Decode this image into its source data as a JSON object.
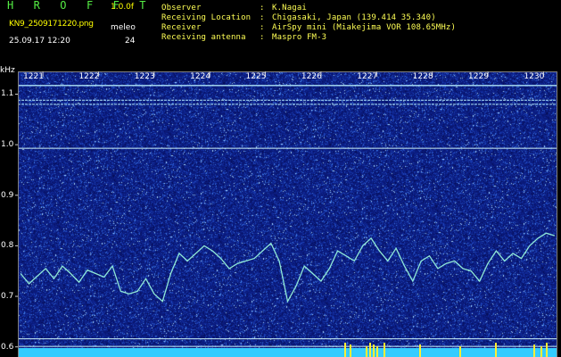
{
  "header": {
    "title": "H R O F F T",
    "version": "1.0.0f",
    "filename": "KN9_2509171220.png",
    "meleo_label": "meleo",
    "datetime": "25.09.17 12:20",
    "meleo_value": "24"
  },
  "info": {
    "rows": [
      {
        "key": "Observer",
        "sep": ":",
        "value": "K.Nagai"
      },
      {
        "key": "Receiving Location",
        "sep": ":",
        "value": "Chigasaki, Japan (139.414 35.340)"
      },
      {
        "key": "Receiver",
        "sep": ":",
        "value": "AirSpy mini (Miakejima VOR 108.65MHz)"
      },
      {
        "key": "Receiving antenna",
        "sep": ":",
        "value": "Maspro FM-3"
      }
    ]
  },
  "colors": {
    "title_green": "#55ee44",
    "info_yellow": "#ffff55",
    "spectrogram_bg": "#0a1a7a",
    "signal": "#9fffe0",
    "noise_bar": "#33ccff",
    "burst": "#ffee33"
  },
  "chart_data": {
    "type": "heatmap",
    "ylabel": "kHz",
    "y_ticks": [
      "1.1",
      "1.0",
      "0.9",
      "0.8",
      "0.7",
      "0.6"
    ],
    "x_ticks": [
      "1221",
      "1222",
      "1223",
      "1224",
      "1225",
      "1226",
      "1227",
      "1228",
      "1229",
      "1230"
    ],
    "ylim": [
      0.58,
      1.145
    ],
    "xlim": [
      1220.55,
      1230.25
    ],
    "steady_lines_khz": [
      1.117,
      1.088,
      1.08,
      0.993,
      0.616,
      0.601
    ],
    "doppler_trace": {
      "x": [
        1220.6,
        1220.75,
        1220.9,
        1221.05,
        1221.2,
        1221.35,
        1221.5,
        1221.65,
        1221.8,
        1221.95,
        1222.1,
        1222.25,
        1222.4,
        1222.55,
        1222.7,
        1222.85,
        1223.0,
        1223.15,
        1223.3,
        1223.45,
        1223.6,
        1223.75,
        1223.9,
        1224.05,
        1224.2,
        1224.35,
        1224.5,
        1224.65,
        1224.8,
        1224.95,
        1225.1,
        1225.25,
        1225.4,
        1225.55,
        1225.7,
        1225.85,
        1226.0,
        1226.15,
        1226.3,
        1226.45,
        1226.6,
        1226.75,
        1226.9,
        1227.05,
        1227.2,
        1227.35,
        1227.5,
        1227.65,
        1227.8,
        1227.95,
        1228.1,
        1228.25,
        1228.4,
        1228.55,
        1228.7,
        1228.85,
        1229.0,
        1229.15,
        1229.3,
        1229.45,
        1229.6,
        1229.75,
        1229.9,
        1230.05,
        1230.2
      ],
      "y": [
        0.745,
        0.725,
        0.74,
        0.755,
        0.735,
        0.76,
        0.745,
        0.728,
        0.752,
        0.745,
        0.738,
        0.76,
        0.71,
        0.705,
        0.71,
        0.735,
        0.705,
        0.69,
        0.745,
        0.785,
        0.77,
        0.785,
        0.8,
        0.79,
        0.775,
        0.755,
        0.765,
        0.77,
        0.775,
        0.79,
        0.805,
        0.77,
        0.69,
        0.72,
        0.76,
        0.745,
        0.73,
        0.755,
        0.79,
        0.78,
        0.77,
        0.8,
        0.815,
        0.79,
        0.77,
        0.795,
        0.76,
        0.73,
        0.77,
        0.78,
        0.755,
        0.765,
        0.77,
        0.755,
        0.75,
        0.73,
        0.765,
        0.79,
        0.77,
        0.785,
        0.775,
        0.8,
        0.815,
        0.825,
        0.82
      ]
    }
  }
}
